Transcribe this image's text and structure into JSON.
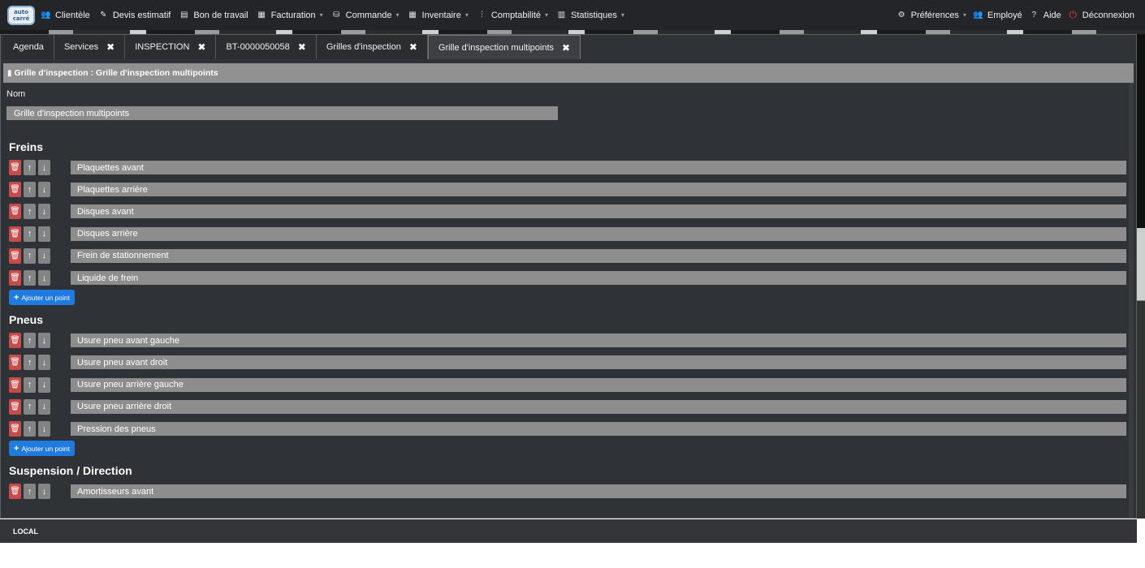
{
  "logo": {
    "text": "auto carré"
  },
  "nav": {
    "left": [
      {
        "label": "Clientèle",
        "icon": "users-icon",
        "glyph": "👥",
        "caret": false
      },
      {
        "label": "Devis estimatif",
        "icon": "edit-icon",
        "glyph": "✎",
        "caret": false
      },
      {
        "label": "Bon de travail",
        "icon": "clipboard-icon",
        "glyph": "▤",
        "caret": false
      },
      {
        "label": "Facturation",
        "icon": "invoice-icon",
        "glyph": "▦",
        "caret": true
      },
      {
        "label": "Commande",
        "icon": "basket-icon",
        "glyph": "⛁",
        "caret": true
      },
      {
        "label": "Inventaire",
        "icon": "list-icon",
        "glyph": "▦",
        "caret": true
      },
      {
        "label": "Comptabilité",
        "icon": "accounting-icon",
        "glyph": "⫶",
        "caret": true
      },
      {
        "label": "Statistiques",
        "icon": "bar-chart-icon",
        "glyph": "▥",
        "caret": true
      }
    ],
    "right": [
      {
        "label": "Préférences",
        "icon": "gear-icon",
        "glyph": "⚙",
        "caret": true
      },
      {
        "label": "Employé",
        "icon": "employee-icon",
        "glyph": "👥",
        "caret": false
      },
      {
        "label": "Aide",
        "icon": "help-icon",
        "glyph": "?",
        "caret": false
      },
      {
        "label": "Déconnexion",
        "icon": "power-icon",
        "glyph": "⏻",
        "caret": false
      }
    ]
  },
  "tabs": [
    {
      "label": "Agenda",
      "closable": false,
      "active": false
    },
    {
      "label": "Services",
      "closable": true,
      "active": false
    },
    {
      "label": "INSPECTION",
      "closable": true,
      "active": false
    },
    {
      "label": "BT-0000050058",
      "closable": true,
      "active": false
    },
    {
      "label": "Grilles d'inspection",
      "closable": true,
      "active": false
    },
    {
      "label": "Grille d'inspection multipoints",
      "closable": true,
      "active": true
    }
  ],
  "breadcrumb": {
    "text": "Grille d'inspection : Grille d'inspection multipoints"
  },
  "form": {
    "nom_label": "Nom",
    "nom_value": "Grille d'inspection multipoints"
  },
  "add_point_label": "Ajouter un point",
  "sections": [
    {
      "title": "Freins",
      "items": [
        "Plaquettes avant",
        "Plaquettes arrière",
        "Disques avant",
        "Disques arrière",
        "Frein de stationnement",
        "Liquide de frein"
      ]
    },
    {
      "title": "Pneus",
      "items": [
        "Usure pneu avant gauche",
        "Usure pneu avant droit",
        "Usure pneu arrière gauche",
        "Usure pneu arrière droit",
        "Pression des pneus"
      ]
    },
    {
      "title": "Suspension / Direction",
      "items": [
        "Amortisseurs avant"
      ]
    }
  ],
  "footer": {
    "text": "LOCAL"
  },
  "colors": {
    "delete": "#c64b4b",
    "add": "#1f7be0",
    "field": "#8e8d8e",
    "panel": "#2f3237"
  }
}
